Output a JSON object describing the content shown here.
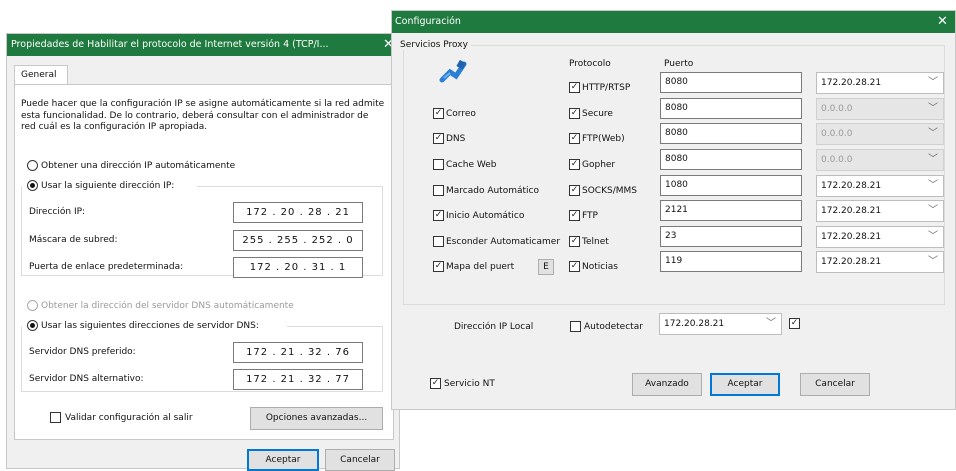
{
  "tcp_dialog": {
    "title": "Propiedades de Habilitar el protocolo de Internet versión 4 (TCP/I...",
    "close_glyph": "✕",
    "tab_general": "General",
    "description": "Puede hacer que la configuración IP se asigne automáticamente si la red admite esta funcionalidad. De lo contrario, deberá consultar con el administrador de red cuál es la configuración IP apropiada.",
    "radio_auto_ip": "Obtener una dirección IP automáticamente",
    "radio_static_ip": "Usar la siguiente dirección IP:",
    "ip_label": "Dirección IP:",
    "ip_value": "172 . 20 . 28 . 21",
    "mask_label": "Máscara de subred:",
    "mask_value": "255 . 255 . 252 . 0",
    "gateway_label": "Puerta de enlace predeterminada:",
    "gateway_value": "172 . 20 . 31 . 1",
    "radio_auto_dns": "Obtener la dirección del servidor DNS automáticamente",
    "radio_static_dns": "Usar las siguientes direcciones de servidor DNS:",
    "dns_pref_label": "Servidor DNS preferido:",
    "dns_pref_value": "172 . 21 . 32 . 76",
    "dns_alt_label": "Servidor DNS alternativo:",
    "dns_alt_value": "172 . 21 . 32 . 77",
    "validate_label": "Validar configuración al salir",
    "advanced_button": "Opciones avanzadas...",
    "ok_button": "Aceptar",
    "cancel_button": "Cancelar"
  },
  "config_dialog": {
    "title": "Configuración",
    "close_glyph": "✕",
    "proxy_group": "Servicios Proxy",
    "col_protocol": "Protocolo",
    "col_port": "Puerto",
    "services": [
      {
        "label": "Correo",
        "checked": true
      },
      {
        "label": "DNS",
        "checked": true
      },
      {
        "label": "Cache Web",
        "checked": false
      },
      {
        "label": "Marcado Automático",
        "checked": false
      },
      {
        "label": "Inicio Automático",
        "checked": true
      },
      {
        "label": "Esconder Automaticamer",
        "checked": false
      },
      {
        "label": "Mapa del puert",
        "checked": true
      }
    ],
    "e_button": "E",
    "protocols": [
      {
        "label": "HTTP/RTSP",
        "port": "8080",
        "ip": "172.20.28.21",
        "enabled": true
      },
      {
        "label": "Secure",
        "port": "8080",
        "ip": "0.0.0.0",
        "enabled": false
      },
      {
        "label": "FTP(Web)",
        "port": "8080",
        "ip": "0.0.0.0",
        "enabled": false
      },
      {
        "label": "Gopher",
        "port": "8080",
        "ip": "0.0.0.0",
        "enabled": false
      },
      {
        "label": "SOCKS/MMS",
        "port": "1080",
        "ip": "172.20.28.21",
        "enabled": true
      },
      {
        "label": "FTP",
        "port": "2121",
        "ip": "172.20.28.21",
        "enabled": true
      },
      {
        "label": "Telnet",
        "port": "23",
        "ip": "172.20.28.21",
        "enabled": true
      },
      {
        "label": "Noticias",
        "port": "119",
        "ip": "172.20.28.21",
        "enabled": true
      }
    ],
    "check_mark": "✓",
    "chevron": "﹀",
    "local_ip_label": "Dirección IP Local",
    "autodetect_label": "Autodetectar",
    "local_ip_value": "172.20.28.21",
    "nt_service_label": "Servicio NT",
    "advanced_button": "Avanzado",
    "ok_button": "Aceptar",
    "cancel_button": "Cancelar"
  },
  "colors": {
    "title_bar": "#1f7a3f",
    "default_button_border": "#0078d7"
  }
}
